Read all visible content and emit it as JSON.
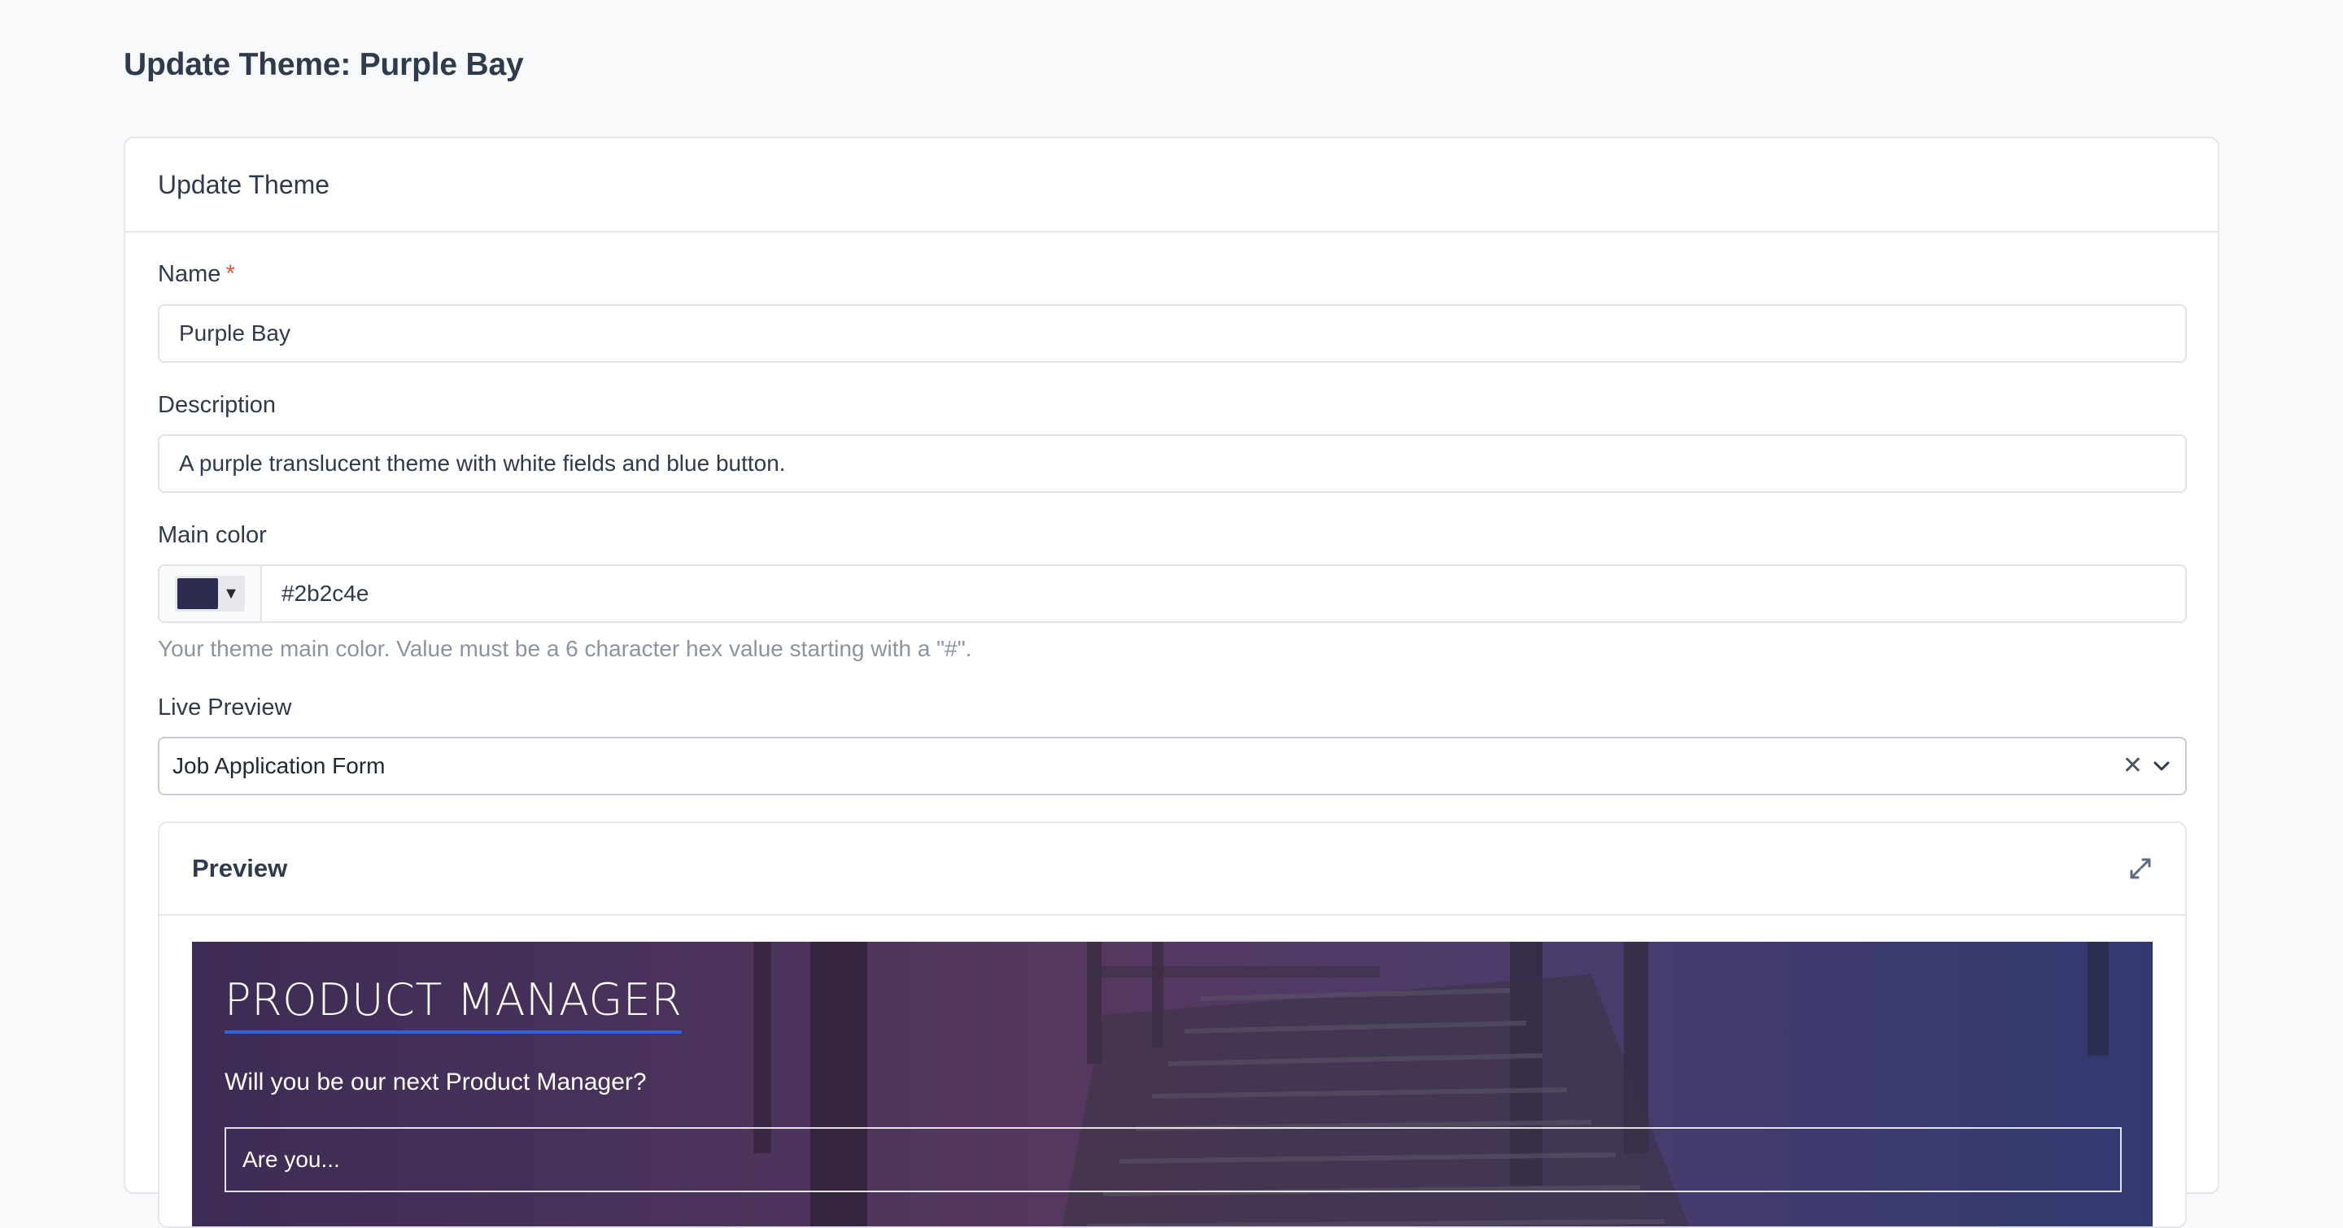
{
  "page": {
    "title": "Update Theme: Purple Bay"
  },
  "card": {
    "header_title": "Update Theme"
  },
  "form": {
    "name": {
      "label": "Name",
      "required_mark": "*",
      "value": "Purple Bay"
    },
    "description": {
      "label": "Description",
      "value": "A purple translucent theme with white fields and blue button."
    },
    "main_color": {
      "label": "Main color",
      "value": "#2b2c4e",
      "swatch_color": "#2b2c4e",
      "caret": "▼",
      "help": "Your theme main color. Value must be a 6 character hex value starting with a \"#\"."
    },
    "live_preview": {
      "label": "Live Preview",
      "selected": "Job Application Form",
      "clear_icon": "✕"
    }
  },
  "preview": {
    "title": "Preview",
    "form_heading": "PRODUCT MANAGER",
    "form_subheading": "Will you be our next Product Manager?",
    "first_field_placeholder": "Are you...",
    "accent_color": "#2e64d8"
  }
}
